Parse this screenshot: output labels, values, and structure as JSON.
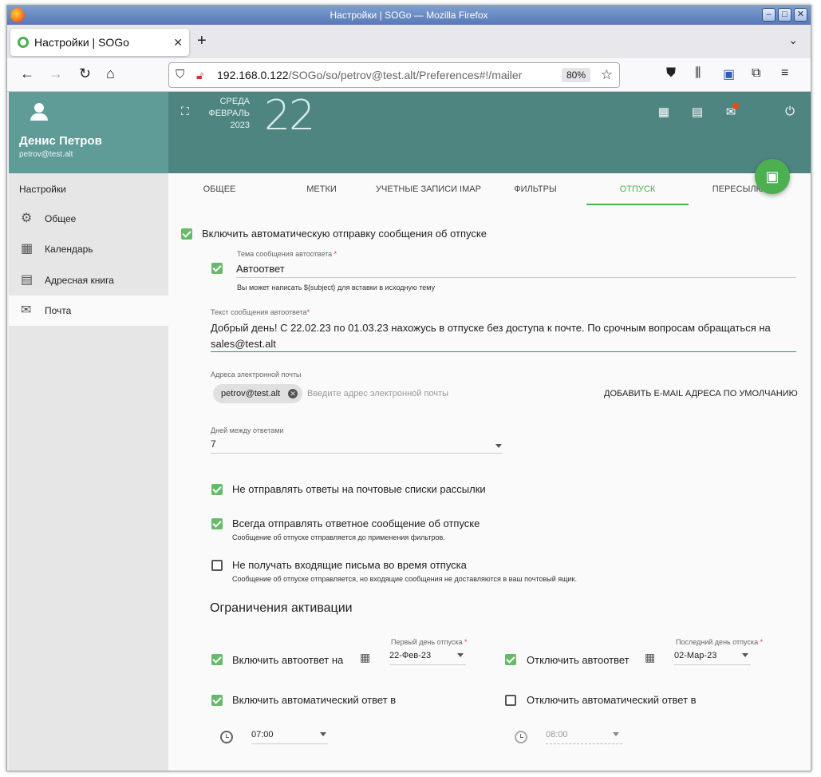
{
  "window": {
    "title": "Настройки | SOGo — Mozilla Firefox"
  },
  "browser": {
    "tab_title": "Настройки | SOGo",
    "url_host": "192.168.0.122",
    "url_path": "/SOGo/so/petrov@test.alt/Preferences#!/mailer",
    "zoom": "80%"
  },
  "user": {
    "name": "Денис Петров",
    "email": "petrov@test.alt"
  },
  "sidebar": {
    "title": "Настройки",
    "items": [
      {
        "label": "Общее",
        "icon": "gear-icon"
      },
      {
        "label": "Календарь",
        "icon": "calendar-icon"
      },
      {
        "label": "Адресная книга",
        "icon": "contacts-icon"
      },
      {
        "label": "Почта",
        "icon": "mail-icon",
        "active": true
      }
    ]
  },
  "header": {
    "weekday": "СРЕДА",
    "month": "ФЕВРАЛЬ",
    "year": "2023",
    "day": "22"
  },
  "tabs": [
    "ОБЩЕЕ",
    "МЕТКИ",
    "УЧЕТНЫЕ ЗАПИСИ IMAP",
    "ФИЛЬТРЫ",
    "ОТПУСК",
    "ПЕРЕСЫЛКА"
  ],
  "active_tab": "ОТПУСК",
  "vacation": {
    "enable_label": "Включить автоматическую отправку сообщения об отпуске",
    "subject_label": "Тема сообщения автоответа",
    "subject_value": "Автоответ",
    "subject_hint": "Вы может написать ${subject} для вставки в исходную тему",
    "body_label": "Текст сообщения автоответа",
    "body_line1": "Добрый день! С 22.02.23 по 01.03.23 нахожусь в отпуске без доступа к почте. По срочным вопросам обращаться на",
    "body_line2": "sales@test.alt",
    "emails_label": "Адреса электронной почты",
    "email_chip": "petrov@test.alt",
    "email_placeholder": "Введите адрес электронной почты",
    "add_default_button": "ДОБАВИТЬ E-MAIL АДРЕСА ПО УМОЛЧАНИЮ",
    "days_label": "Дней между ответами",
    "days_value": "7",
    "no_lists_label": "Не отправлять ответы на почтовые списки рассылки",
    "always_label": "Всегда отправлять ответное сообщение об отпуске",
    "always_hint": "Сообщение об отпуске отправляется до применения фильтров.",
    "discard_label": "Не получать входящие письма во время отпуска",
    "discard_hint": "Сообщение об отпуске отправляется, но входящие сообщения не доставляются в ваш почтовый ящик.",
    "activation_title": "Ограничения активации",
    "enable_on_label": "Включить автоответ на",
    "first_day_label": "Первый день отпуска",
    "first_day_value": "22-Фев-23",
    "disable_label": "Отключить автоответ",
    "last_day_label": "Последний день отпуска",
    "last_day_value": "02-Мар-23",
    "enable_at_label": "Включить автоматический ответ в",
    "enable_time": "07:00",
    "disable_at_label": "Отключить автоматический ответ в",
    "disable_time": "08:00"
  }
}
